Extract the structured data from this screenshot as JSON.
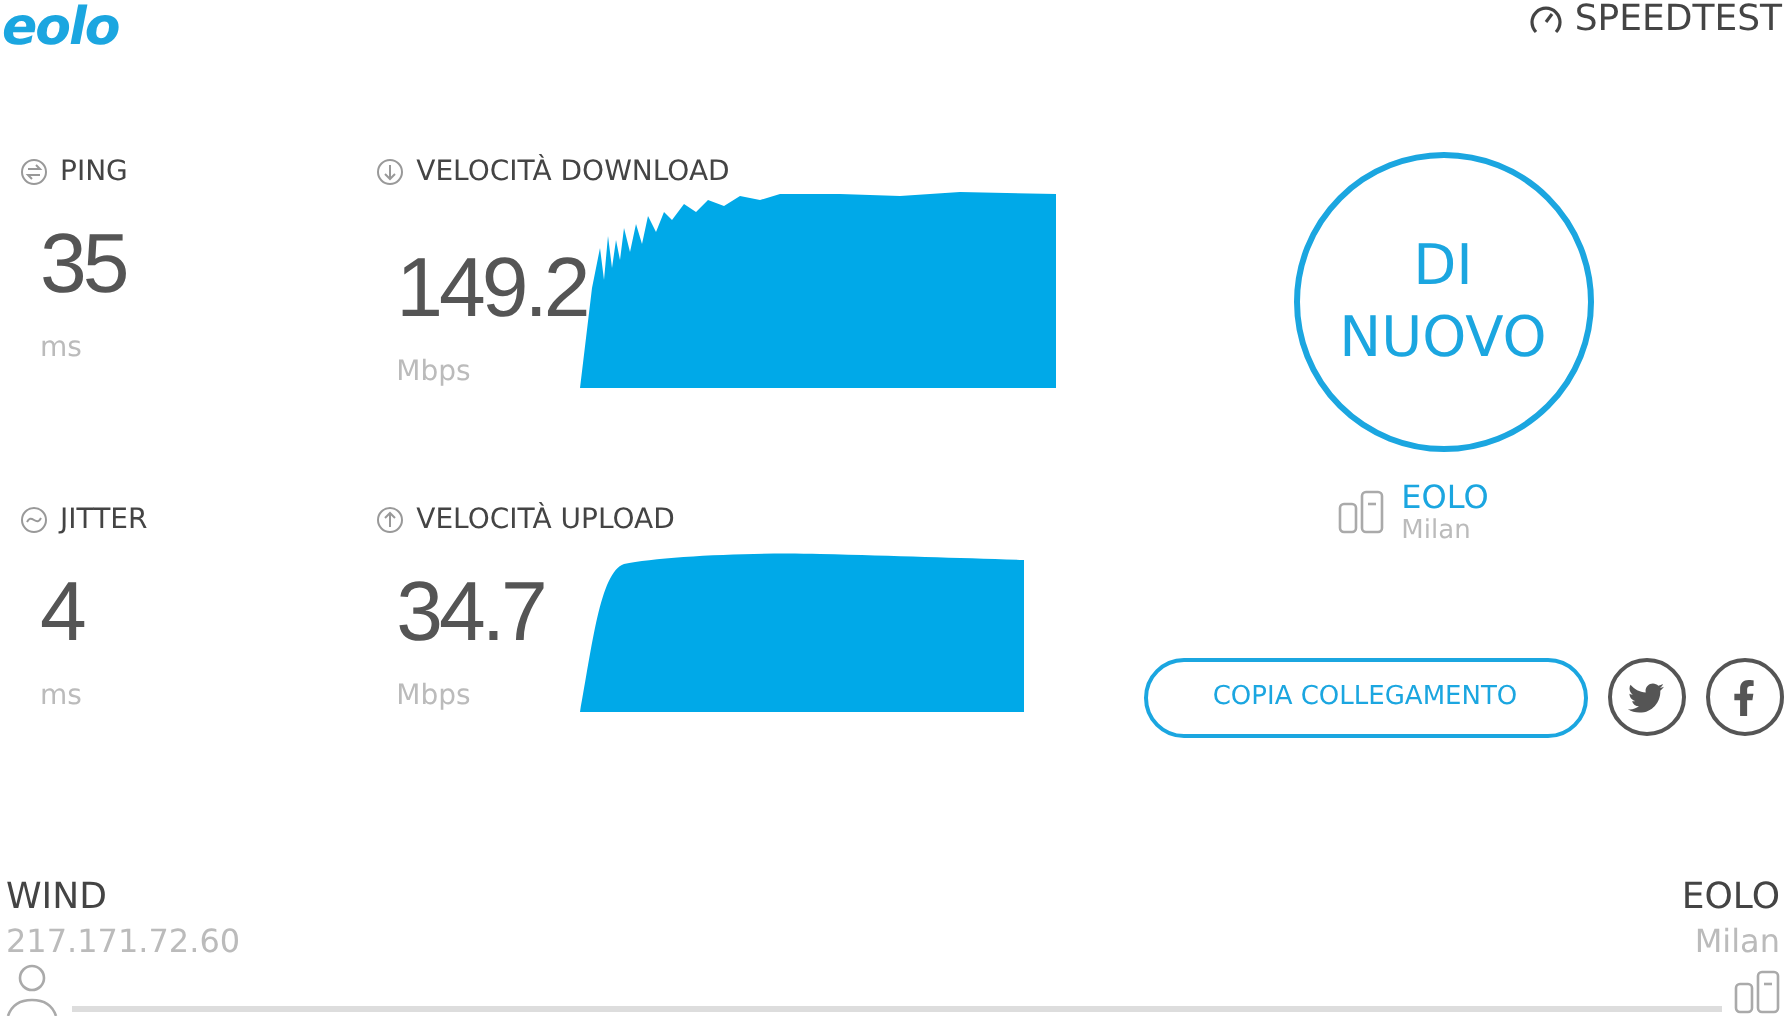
{
  "logo": {
    "text": "eolo"
  },
  "header": {
    "brand": "SPEEDTEST"
  },
  "metrics": [
    {
      "kind": "ping",
      "label": "PING",
      "value": "35",
      "unit": "ms"
    },
    {
      "kind": "download",
      "label": "VELOCITÀ DOWNLOAD",
      "value": "149.2",
      "unit": "Mbps"
    },
    {
      "kind": "jitter",
      "label": "JITTER",
      "value": "4",
      "unit": "ms"
    },
    {
      "kind": "upload",
      "label": "VELOCITÀ UPLOAD",
      "value": "34.7",
      "unit": "Mbps"
    }
  ],
  "restart_button": {
    "label": "DI NUOVO"
  },
  "server": {
    "name": "EOLO",
    "location": "Milan"
  },
  "copy_link_button": {
    "label": "COPIA COLLEGAMENTO"
  },
  "share_buttons": [
    {
      "kind": "twitter"
    },
    {
      "kind": "facebook"
    }
  ],
  "connection": {
    "client": {
      "isp": "WIND",
      "ip": "217.171.72.60"
    },
    "server": {
      "name": "EOLO",
      "location": "Milan"
    }
  }
}
